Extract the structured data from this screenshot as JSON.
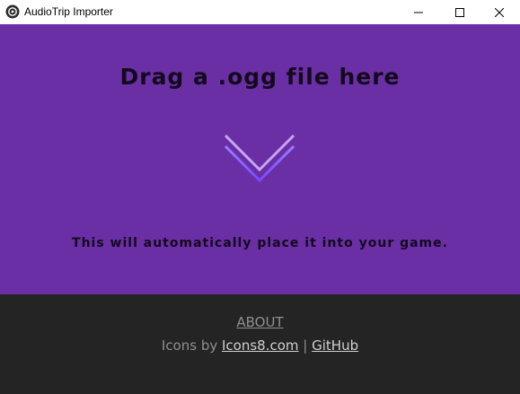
{
  "window": {
    "title": "AudioTrip Importer",
    "icon": "app-logo-icon",
    "controls": [
      "minimize-icon",
      "maximize-icon",
      "close-icon"
    ]
  },
  "dropzone": {
    "heading": "Drag a .ogg file here",
    "icon": "chevron-down-icon",
    "subtitle": "This will automatically place it into your game.",
    "background_color": "#6a2ea5"
  },
  "footer": {
    "about_label": "ABOUT",
    "credits_prefix": "Icons by ",
    "icons8_label": "Icons8.com",
    "separator": " | ",
    "github_label": "GitHub",
    "background_color": "#242424"
  }
}
